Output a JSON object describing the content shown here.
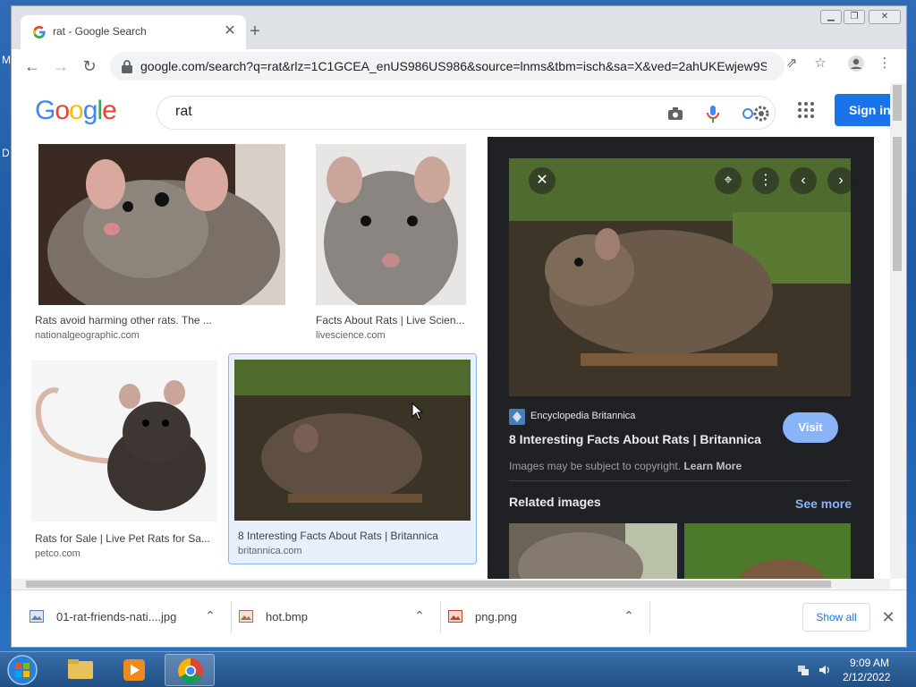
{
  "browser": {
    "tab_title": "rat - Google Search",
    "url": "google.com/search?q=rat&rlz=1C1GCEA_enUS986US986&source=lnms&tbm=isch&sa=X&ved=2ahUKEwjew9S..."
  },
  "google": {
    "logo": "Google",
    "query": "rat",
    "signin_label": "Sign in"
  },
  "results": [
    {
      "caption": "Rats avoid harming other rats. The ...",
      "source": "nationalgeographic.com"
    },
    {
      "caption": "Facts About Rats | Live Scien...",
      "source": "livescience.com"
    },
    {
      "caption": "Rats for Sale | Live Pet Rats for Sa...",
      "source": "petco.com"
    },
    {
      "caption": "8 Interesting Facts About Rats | Britannica",
      "source": "britannica.com"
    }
  ],
  "panel": {
    "source": "Encyclopedia Britannica",
    "title": "8 Interesting Facts About Rats | Britannica",
    "visit_label": "Visit",
    "copyright": "Images may be subject to copyright.",
    "learn_more": "Learn More",
    "related_title": "Related images",
    "see_more": "See more"
  },
  "downloads": {
    "items": [
      {
        "name": "01-rat-friends-nati....jpg"
      },
      {
        "name": "hot.bmp"
      },
      {
        "name": "png.png"
      }
    ],
    "show_all": "Show all"
  },
  "taskbar": {
    "time": "9:09 AM",
    "date": "2/12/2022"
  },
  "colors": {
    "google_blue": "#4285f4",
    "google_red": "#ea4335",
    "google_yellow": "#fbbc05",
    "google_green": "#34a853",
    "signin_bg": "#1a73e8",
    "panel_bg": "#202124",
    "visit_bg": "#8ab4f8"
  },
  "icons": [
    "google-favicon-icon",
    "close-icon",
    "plus-icon",
    "back-arrow-icon",
    "forward-arrow-icon",
    "reload-icon",
    "lock-icon",
    "share-icon",
    "star-icon",
    "profile-icon",
    "kebab-menu-icon",
    "camera-icon",
    "mic-icon",
    "settings-icon",
    "apps-grid-icon",
    "lens-icon",
    "chevron-left-icon",
    "chevron-right-icon",
    "chevron-up-icon",
    "windows-start-icon",
    "folder-icon",
    "media-player-icon",
    "chrome-icon",
    "network-icon",
    "volume-icon"
  ]
}
